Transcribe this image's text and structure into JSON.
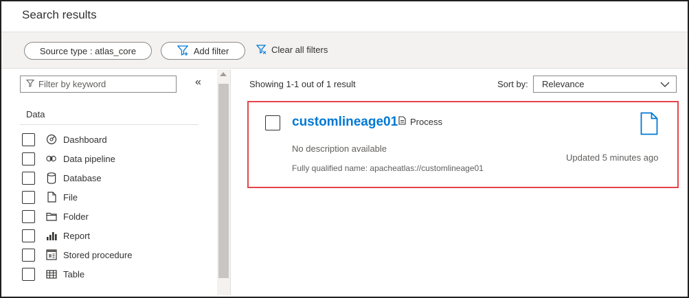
{
  "header": {
    "title": "Search results"
  },
  "filters": {
    "source_type_pill": "Source type : atlas_core",
    "add_filter_label": "Add filter",
    "clear_all_label": "Clear all filters"
  },
  "sidebar": {
    "keyword_placeholder": "Filter by keyword",
    "collapse_glyph": "«",
    "section_label": "Data",
    "items": [
      {
        "label": "Dashboard",
        "icon": "dashboard-icon",
        "checked": false
      },
      {
        "label": "Data pipeline",
        "icon": "data-pipeline-icon",
        "checked": false
      },
      {
        "label": "Database",
        "icon": "database-icon",
        "checked": false
      },
      {
        "label": "File",
        "icon": "file-icon",
        "checked": false
      },
      {
        "label": "Folder",
        "icon": "folder-icon",
        "checked": false
      },
      {
        "label": "Report",
        "icon": "report-icon",
        "checked": false
      },
      {
        "label": "Stored procedure",
        "icon": "stored-procedure-icon",
        "checked": false
      },
      {
        "label": "Table",
        "icon": "table-icon",
        "checked": false
      }
    ]
  },
  "results": {
    "summary": "Showing 1-1 out of 1 result",
    "sort_label": "Sort by:",
    "sort_value": "Relevance",
    "items": [
      {
        "name": "customlineage01",
        "type": "Process",
        "description": "No description available",
        "qualified_name": "Fully qualified name: apacheatlas://customlineage01",
        "updated": "Updated 5 minutes ago",
        "icon": "document-icon",
        "checked": false
      }
    ]
  },
  "colors": {
    "accent": "#0078d4",
    "highlight_border": "#e5434b",
    "filter_bar_bg": "#f3f2f1"
  }
}
